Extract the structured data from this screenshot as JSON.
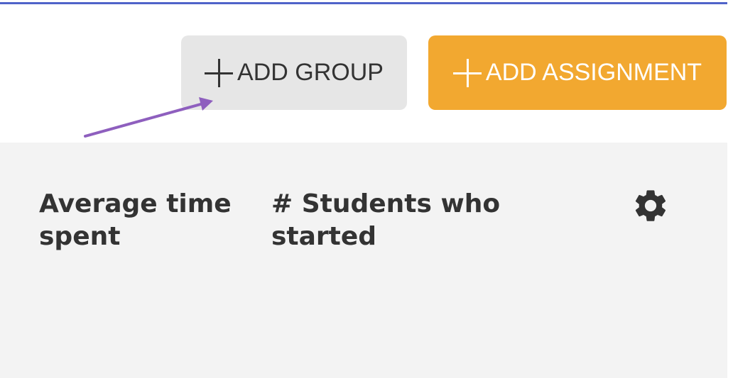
{
  "toolbar": {
    "add_group_label": "ADD GROUP",
    "add_assignment_label": "ADD ASSIGNMENT",
    "add_icon": "plus-icon"
  },
  "table": {
    "columns": [
      {
        "label_line1": "Average time",
        "label_line2": "spent"
      },
      {
        "label_line1": "# Students who",
        "label_line2": "started"
      }
    ],
    "settings_icon": "gear-icon"
  },
  "colors": {
    "accent_line": "#4f63c9",
    "primary_button": "#f2a830",
    "secondary_button": "#e6e6e6",
    "table_background": "#f3f3f3",
    "annotation_arrow": "#8e5fbe"
  }
}
